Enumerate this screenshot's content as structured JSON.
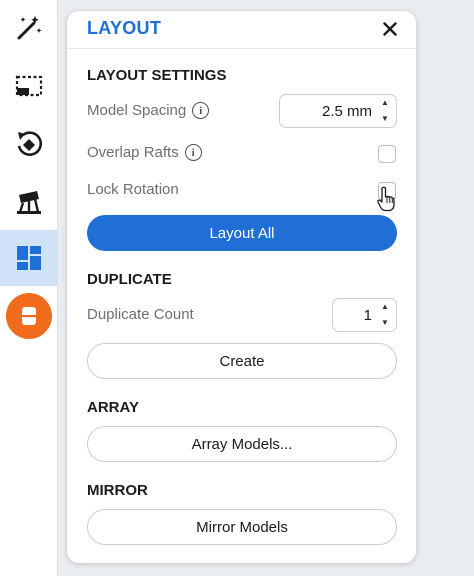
{
  "toolbar": {
    "items": [
      {
        "icon": "magic-wand-icon"
      },
      {
        "icon": "select-region-icon"
      },
      {
        "icon": "rotate-icon"
      },
      {
        "icon": "support-tree-icon"
      },
      {
        "icon": "layout-grid-icon",
        "active": true
      },
      {
        "icon": "orange-model-icon"
      }
    ]
  },
  "panel": {
    "title": "LAYOUT",
    "close_icon": "close-icon",
    "layout_settings": {
      "heading": "LAYOUT SETTINGS",
      "model_spacing_label": "Model Spacing",
      "model_spacing_value": "2.5 mm",
      "overlap_rafts_label": "Overlap Rafts",
      "lock_rotation_label": "Lock Rotation",
      "layout_all_label": "Layout All"
    },
    "duplicate": {
      "heading": "DUPLICATE",
      "count_label": "Duplicate Count",
      "count_value": "1",
      "create_label": "Create"
    },
    "array": {
      "heading": "ARRAY",
      "button_label": "Array Models..."
    },
    "mirror": {
      "heading": "MIRROR",
      "button_label": "Mirror Models"
    }
  },
  "colors": {
    "accent": "#1f6fd6",
    "orange": "#f26a1b",
    "active_tool_bg": "#cfe2f6"
  }
}
